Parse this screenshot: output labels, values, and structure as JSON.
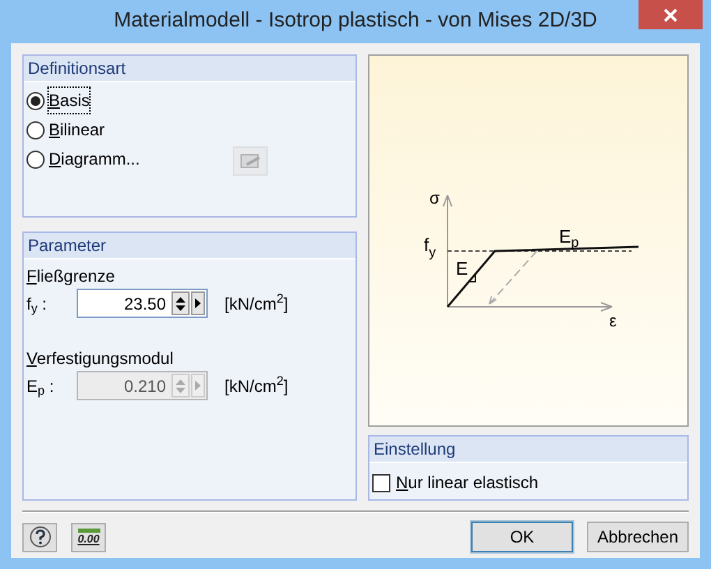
{
  "window": {
    "title": "Materialmodell - Isotrop plastisch - von Mises 2D/3D"
  },
  "definition": {
    "title": "Definitionsart",
    "options": [
      {
        "label": "Basis",
        "selected": true
      },
      {
        "label": "Bilinear",
        "selected": false
      },
      {
        "label": "Diagramm...",
        "selected": false
      }
    ],
    "diagram_button": {
      "disabled": true
    }
  },
  "parameters": {
    "title": "Parameter",
    "fields": [
      {
        "heading": "Fließgrenze",
        "symbol": "f$_{y}$ :",
        "value": "23.50",
        "unit": "[kN/cm$^{2}$]",
        "disabled": false
      },
      {
        "heading": "Verfestigungsmodul",
        "symbol": "E$_{p}$ :",
        "value": "0.210",
        "unit": "[kN/cm$^{2}$]",
        "disabled": true
      }
    ]
  },
  "diagram": {
    "labels": {
      "stress": "σ",
      "yield": "f",
      "yield_sub": "y",
      "modulus": "E",
      "hardening": "E",
      "hardening_sub": "p",
      "strain": "ε"
    }
  },
  "settings": {
    "title": "Einstellung",
    "checkbox": {
      "label": "Nur linear elastisch",
      "checked": false
    }
  },
  "footer": {
    "units_icon_text": "0.00",
    "buttons": [
      {
        "label": "OK",
        "kind": "default"
      },
      {
        "label": "Abbrechen",
        "kind": "normal"
      }
    ]
  }
}
